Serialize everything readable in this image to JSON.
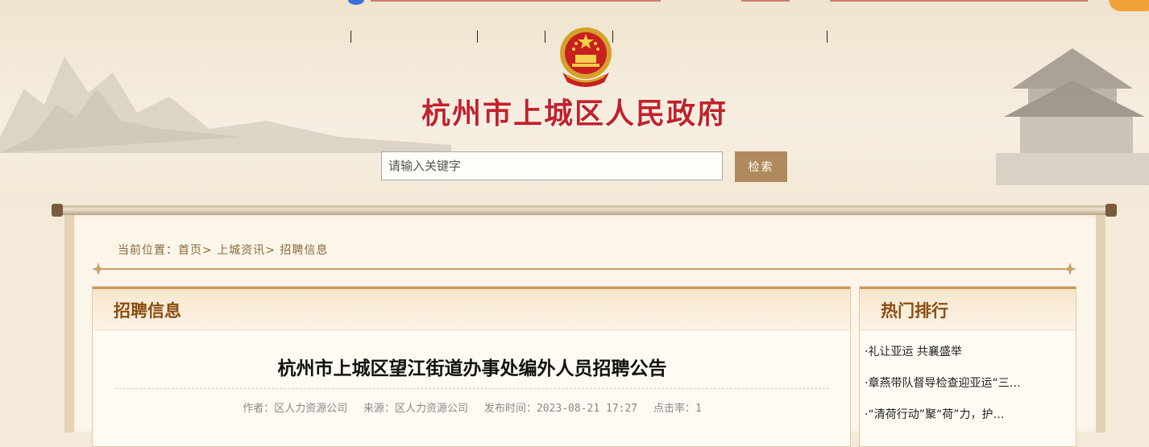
{
  "header": {
    "site_title": "杭州市上城区人民政府",
    "search_placeholder": "请输入关键字",
    "search_button": "检索"
  },
  "breadcrumb": {
    "prefix": "当前位置：",
    "items": [
      "首页",
      "上城资讯",
      "招聘信息"
    ],
    "separator": ">"
  },
  "main": {
    "section_title": "招聘信息",
    "article": {
      "title": "杭州市上城区望江街道办事处编外人员招聘公告",
      "author": "作者：区人力资源公司",
      "source": "来源：区人力资源公司",
      "published": "发布时间：2023-08-21 17:27",
      "clicks": "点击率：1"
    }
  },
  "sidebar": {
    "title": "热门排行",
    "items": [
      "·礼让亚运 共襄盛举",
      "·章燕带队督导检查迎亚运“三…",
      "·“清荷行动”聚“荷”力，护…"
    ]
  },
  "colors": {
    "title_red": "#c2222a",
    "accent_brown": "#b08a5c",
    "section_title": "#8a4d12"
  }
}
